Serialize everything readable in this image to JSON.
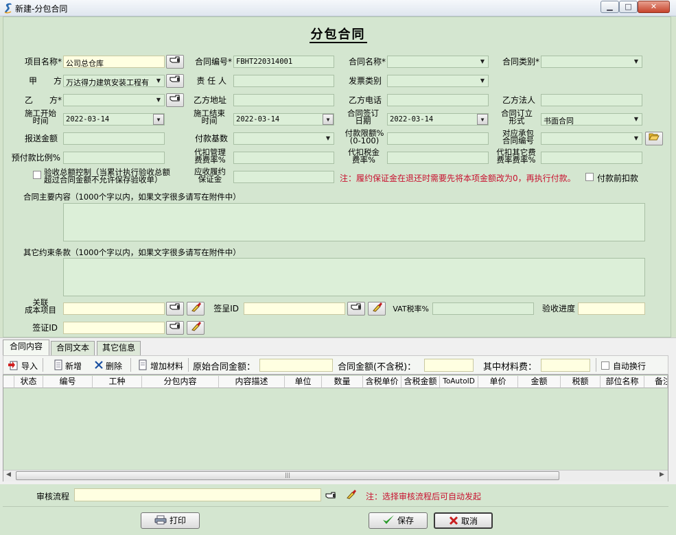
{
  "window": {
    "title": "新建-分包合同",
    "minimize": "▁",
    "maximize": "□",
    "close": "✕"
  },
  "form": {
    "title": "分包合同",
    "row1": {
      "project_name_label": "项目名称*",
      "project_name_value": "公司总仓库",
      "contract_no_label": "合同编号*",
      "contract_no_value": "FBHT220314001",
      "contract_name_label": "合同名称*",
      "contract_type_label": "合同类别*"
    },
    "row2": {
      "party_a_label": "甲　　方",
      "party_a_value": "万达得力建筑安装工程有",
      "responsible_label": "责 任 人",
      "invoice_type_label": "发票类别"
    },
    "row3": {
      "party_b_label": "乙　　方*",
      "party_b_address_label": "乙方地址",
      "party_b_phone_label": "乙方电话",
      "party_b_legal_label": "乙方法人"
    },
    "row4": {
      "start_time_label": "施工开始\n时间",
      "start_time_value": "2022-03-14",
      "end_time_label": "施工结束\n时间",
      "end_time_value": "2022-03-14",
      "sign_date_label": "合同签订\n日期",
      "sign_date_value": "2022-03-14",
      "form_label": "合同订立\n形式",
      "form_value": "书面合同"
    },
    "row5": {
      "report_amount_label": "报送金额",
      "payment_base_label": "付款基数",
      "payment_limit_label": "付款限额%\n(0-100)",
      "related_contract_label": "对应承包\n合同编号"
    },
    "row6": {
      "prepay_ratio_label": "预付款比例%",
      "mgmt_fee_label": "代扣管理\n费费率%",
      "tax_fee_label": "代扣税金\n费率%",
      "other_fee_label": "代扣其它费\n费率费率%"
    },
    "row7": {
      "acceptance_control_label": "验收总额控制（当累计执行验收总额\n超过合同金额不允许保存验收单）",
      "deposit_label": "应收履约\n保证金",
      "deposit_note": "注：履约保证金在退还时需要先将本项金额改为0，再执行付款。",
      "deduct_before_pay_label": "付款前扣款"
    },
    "main_content_label": "合同主要内容（1000个字以内，如果文字很多请写在附件中）",
    "other_terms_label": "其它约束条款（1000个字以内，如果文字很多请写在附件中）",
    "cost_item_label": "关联\n成本项目",
    "visa_label": "签呈ID",
    "vat_label": "VAT税率%",
    "acceptance_progress_label": "验收进度",
    "sign_id_label": "签证ID"
  },
  "tabs": [
    "合同内容",
    "合同文本",
    "其它信息"
  ],
  "toolbar": {
    "import": "导入",
    "add": "新增",
    "delete": "删除",
    "add_material": "增加材料",
    "original_amount": "原始合同金额：",
    "amount_ex_tax": "合同金额(不含税)：",
    "material_fee": "其中材料费：",
    "auto_wrap": "自动换行"
  },
  "grid": {
    "columns": [
      "状态",
      "编号",
      "工种",
      "分包内容",
      "内容描述",
      "单位",
      "数量",
      "含税单价",
      "含税金额",
      "ToAutoID",
      "单价",
      "金额",
      "税额",
      "部位名称",
      "备注"
    ]
  },
  "footer": {
    "workflow_label": "审核流程",
    "workflow_note": "注：选择审核流程后可自动发起",
    "print": "打印",
    "save": "保存",
    "cancel": "取消"
  }
}
